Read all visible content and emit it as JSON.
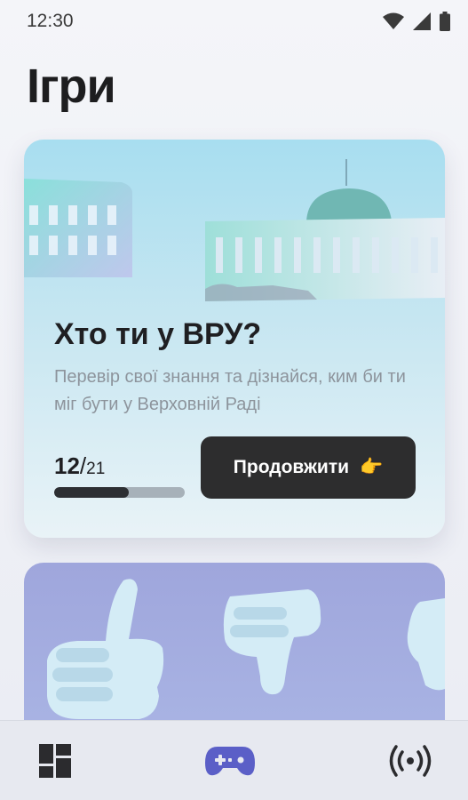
{
  "status_bar": {
    "time": "12:30",
    "icons": [
      "wifi-icon",
      "cell-signal-icon",
      "battery-icon"
    ]
  },
  "page": {
    "title": "Ігри"
  },
  "games": [
    {
      "title": "Хто ти у ВРУ?",
      "description": "Перевір свої знання та дізнайся, ким би ти міг бути у Верховній Раді",
      "progress": {
        "current": "12",
        "separator": "/",
        "total": "21",
        "fraction": 0.571
      },
      "button_label": "Продовжити",
      "button_emoji": "👉",
      "image": "verkhovna-rada-building"
    },
    {
      "image": "thumbs-up-down-hands"
    }
  ],
  "bottom_nav": {
    "items": [
      {
        "icon": "dashboard-icon",
        "active": false
      },
      {
        "icon": "gamepad-icon",
        "active": true
      },
      {
        "icon": "broadcast-icon",
        "active": false
      }
    ]
  },
  "colors": {
    "accent": "#5b5fc7",
    "button_bg": "#2d2d2e",
    "card_top": "#a8def0",
    "card2": "#a3acdf"
  }
}
